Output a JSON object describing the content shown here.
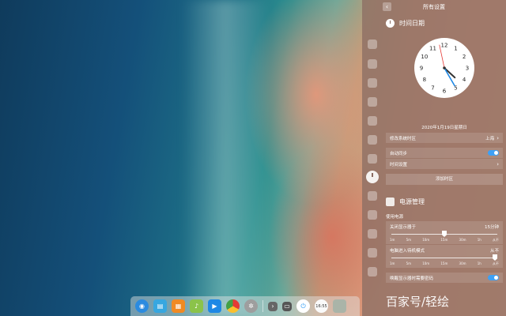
{
  "panel": {
    "title": "所有设置",
    "back": "‹"
  },
  "datetime": {
    "section_title": "时间日期",
    "clock": {
      "hour": 4,
      "minute": 25,
      "second": 58
    },
    "clock_numbers": [
      "12",
      "1",
      "2",
      "3",
      "4",
      "5",
      "6",
      "7",
      "8",
      "9",
      "10",
      "11"
    ],
    "date_text": "2020年1月19日星期日",
    "timezone_label": "修改系统时区",
    "timezone_value": "上海",
    "auto_sync_label": "自动同步",
    "auto_sync_on": true,
    "time_settings_label": "时间设置",
    "add_timezone_label": "添加时区"
  },
  "power": {
    "section_title": "电源管理",
    "subsection": "使用电源",
    "display_off_label": "关闭显示器于",
    "display_off_value": "15分钟",
    "display_off_ticks": [
      "1m",
      "5m",
      "10m",
      "15m",
      "30m",
      "1h",
      "从不"
    ],
    "display_off_level": 0.5,
    "standby_label": "电脑进入待机模式",
    "standby_value": "从不",
    "standby_ticks": [
      "1m",
      "5m",
      "10m",
      "15m",
      "30m",
      "1h",
      "从不"
    ],
    "standby_level": 1.0,
    "wake_password_label": "唤醒显示器时需要密码"
  },
  "watermark": "百家号/轻绘",
  "dock": {
    "items": [
      {
        "name": "launcher-icon",
        "color": "#2b8be0"
      },
      {
        "name": "file-manager-icon",
        "color": "#37a7e0"
      },
      {
        "name": "app-store-icon",
        "color": "#f08a24"
      },
      {
        "name": "music-icon",
        "color": "#8bc34a"
      },
      {
        "name": "video-icon",
        "color": "#1e88e5"
      },
      {
        "name": "browser-icon",
        "color": "#e53935"
      },
      {
        "name": "settings-icon",
        "color": "#9e9e9e"
      },
      {
        "name": "chevron-icon",
        "color": "#666666"
      },
      {
        "name": "keyboard-icon",
        "color": "#555555"
      },
      {
        "name": "power-icon",
        "color": "#2196f3"
      },
      {
        "name": "clock-icon",
        "color": "#fafafa"
      },
      {
        "name": "trash-icon",
        "color": "#aab4a8"
      }
    ],
    "tray_time": "16:55"
  },
  "accent_color": "#3da0f5"
}
